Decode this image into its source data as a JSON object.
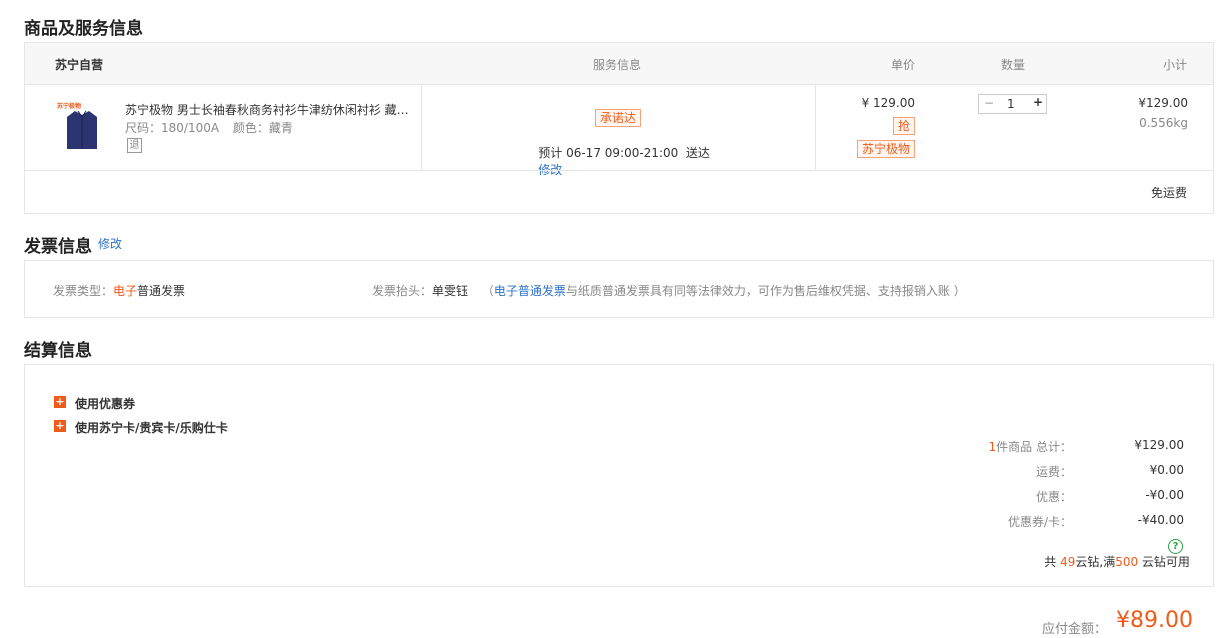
{
  "goods": {
    "title": "商品及服务信息",
    "store": "苏宁自营",
    "headers": {
      "service": "服务信息",
      "price": "单价",
      "qty": "数量",
      "subtotal": "小计"
    },
    "item": {
      "logo_text": "苏宁极物",
      "name": "苏宁极物 男士长袖春秋商务衬衫牛津纺休闲衬衫 藏…",
      "size_label": "尺码：",
      "size": "180/100A",
      "color_label": "颜色：",
      "color": "藏青",
      "return_badge": "退",
      "promise_tag": "承诺达",
      "delivery": "预计 06-17 09:00-21:00  送达",
      "delivery_edit": "修改",
      "price": "¥ 129.00",
      "grab_tag": "抢",
      "brand_tag": "苏宁极物",
      "qty_minus": "−",
      "qty": "1",
      "qty_plus": "+",
      "subtotal": "¥129.00",
      "weight": "0.556kg"
    },
    "shipping": "免运费"
  },
  "invoice": {
    "title": "发票信息",
    "edit": "修改",
    "type_label": "发票类型：",
    "type_highlight": "电子",
    "type_rest": "普通发票",
    "head_label": "发票抬头：",
    "head_value": "单雯钰",
    "note_open": "（",
    "note_link": "电子普通发票",
    "note_text": "与纸质普通发票具有同等法律效力，可作为售后维权凭据、支持报销入账 ）"
  },
  "settlement": {
    "title": "结算信息",
    "coupon": "使用优惠券",
    "card": "使用苏宁卡/贵宾卡/乐购仕卡",
    "plus": "+",
    "rows": [
      {
        "label_num": "1",
        "label": "件商品 总计：",
        "value": "¥129.00"
      },
      {
        "label_num": "",
        "label": "运费：",
        "value": "¥0.00"
      },
      {
        "label_num": "",
        "label": "优惠：",
        "value": "-¥0.00"
      },
      {
        "label_num": "",
        "label": "优惠券/卡：",
        "value": "-¥40.00"
      }
    ],
    "diamond_pre": "共 ",
    "diamond_num1": "49",
    "diamond_mid": "云钻,满",
    "diamond_num2": "500",
    "diamond_post": " 云钻可用",
    "help": "?"
  },
  "payable": {
    "label": "应付金额：",
    "amount": "¥89.00"
  },
  "colors": {
    "accent": "#f05a1a",
    "link": "#2b72c8",
    "green": "#2ba245"
  }
}
